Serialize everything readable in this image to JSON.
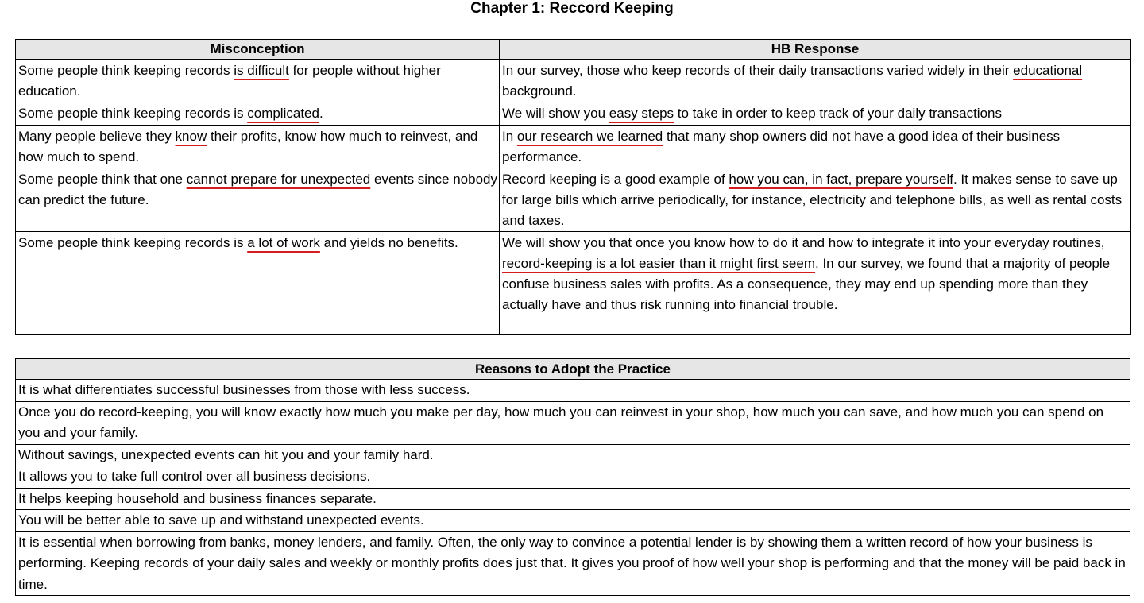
{
  "title": "Chapter 1:  Reccord Keeping",
  "misconception_table": {
    "headers": {
      "misconception": "Misconception",
      "response": "HB Response"
    },
    "rows": [
      {
        "misconception": [
          {
            "t": "Some people think keeping records "
          },
          {
            "t": "is difficult",
            "u": true
          },
          {
            "t": " for people without higher education."
          }
        ],
        "response": [
          {
            "t": "In our survey, those who keep records of their daily transactions varied widely in their "
          },
          {
            "t": "educational",
            "u": true
          },
          {
            "t": " background."
          }
        ]
      },
      {
        "misconception": [
          {
            "t": "Some people think keeping records is "
          },
          {
            "t": "complicated",
            "u": true
          },
          {
            "t": "."
          }
        ],
        "response": [
          {
            "t": "We will show you "
          },
          {
            "t": "easy steps",
            "u": true
          },
          {
            "t": " to take in order to keep track of your daily transactions"
          }
        ]
      },
      {
        "misconception": [
          {
            "t": "Many people believe they "
          },
          {
            "t": "know",
            "u": true
          },
          {
            "t": " their profits, know how much to reinvest, and how much to spend."
          }
        ],
        "response": [
          {
            "t": "In "
          },
          {
            "t": "our research we learned",
            "u": true
          },
          {
            "t": " that many shop owners did not have a good idea of their business performance."
          }
        ]
      },
      {
        "misconception": [
          {
            "t": "Some people think that one "
          },
          {
            "t": "cannot prepare for unexpected",
            "u": true
          },
          {
            "t": " events since nobody can predict the future."
          }
        ],
        "response": [
          {
            "t": "Record keeping is a good example of "
          },
          {
            "t": "how you can, in fact, prepare yourself",
            "u": true
          },
          {
            "t": ". It makes sense to save up for large bills which arrive periodically, for instance, electricity and telephone bills, as well as rental costs and taxes."
          }
        ]
      },
      {
        "misconception": [
          {
            "t": "Some people think keeping records is "
          },
          {
            "t": "a lot of work",
            "u": true
          },
          {
            "t": " and yields no benefits."
          }
        ],
        "response": [
          {
            "t": "We will show you that once you know how to do it and how to integrate it into your everyday routines, "
          },
          {
            "t": "record-keeping is a lot easier than it might first seem",
            "u": true
          },
          {
            "t": ". In our survey, we found that a majority of people confuse business sales with profits. As a consequence, they may end up spending more than they actually have and thus risk running into financial trouble."
          }
        ]
      }
    ]
  },
  "reasons_table": {
    "header": "Reasons to Adopt the Practice",
    "rows": [
      "It is what differentiates successful businesses from those with less success.",
      "Once you do record-keeping, you will know exactly how much you make per day, how much you can reinvest in your shop, how much you can save, and how much you can spend on you and your family.",
      "Without savings, unexpected events can hit you and your family hard.",
      "It allows you to take full control over all business decisions.",
      "It helps keeping household and business finances separate.",
      "You will be better able to save up and withstand unexpected events.",
      "It is essential when borrowing from banks, money lenders, and family. Often, the only way to convince a potential lender is by showing them a written record of how your business is performing. Keeping records of your daily sales and weekly or monthly profits does just that. It gives you proof of how well your shop is performing and that the money will be paid back in time."
    ]
  },
  "colors": {
    "annotation_underline": "#d41c1c",
    "header_bg": "#e6e6e6",
    "border": "#000000"
  }
}
